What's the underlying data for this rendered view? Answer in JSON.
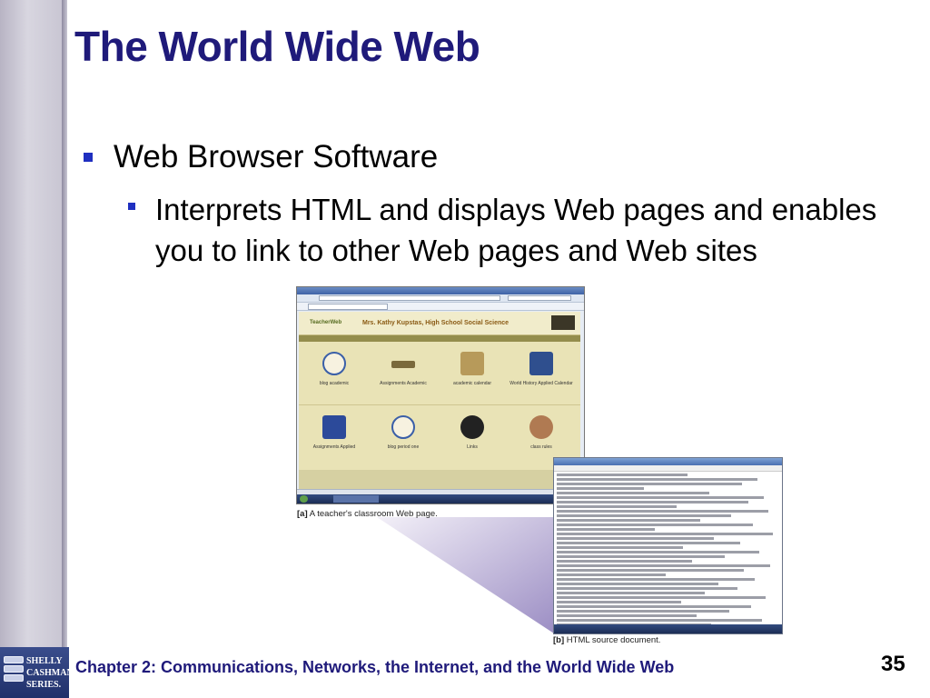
{
  "slide": {
    "title": "The World Wide Web",
    "bullets": [
      {
        "text": "Web Browser Software",
        "level": 1
      },
      {
        "text": "Interprets HTML and displays Web pages and enables you to link to other Web pages and Web sites",
        "level": 2
      }
    ],
    "footer": "Chapter 2: Communications, Networks, the Internet, and the World Wide Web",
    "page_number": "35"
  },
  "logo": {
    "line1": "SHELLY",
    "line2": "CASHMAN",
    "line3": "SERIES."
  },
  "figure": {
    "caption_a_tag": "[a]",
    "caption_a": "A teacher's classroom Web page.",
    "caption_b_tag": "[b]",
    "caption_b": "HTML source document.",
    "browser": {
      "page_header": "Mrs. Kathy Kupstas, High School Social Science",
      "logo_text": "TeacherWeb",
      "tiles": [
        "blog academic",
        "Assignments Academic",
        "academic calendar",
        "World History Applied Calendar",
        "Assignments Applied",
        "blog period one",
        "Links",
        "class rules"
      ]
    }
  },
  "colors": {
    "title": "#1f1a7a",
    "bullet": "#1f2fc0",
    "footer": "#1f1a7a",
    "left_band": "#c9c6d3"
  }
}
